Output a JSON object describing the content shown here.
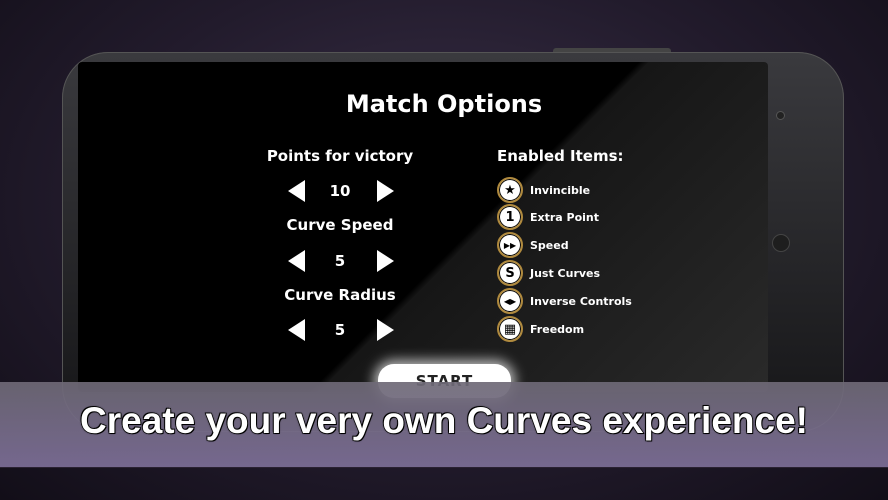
{
  "title": "Match Options",
  "settings": [
    {
      "label": "Points for victory",
      "value": "10"
    },
    {
      "label": "Curve Speed",
      "value": "5"
    },
    {
      "label": "Curve Radius",
      "value": "5"
    }
  ],
  "enabled_items": {
    "heading": "Enabled Items:",
    "items": [
      {
        "label": "Invincible",
        "icon": "star-icon",
        "glyph": "★"
      },
      {
        "label": "Extra Point",
        "icon": "one-icon",
        "glyph": "1"
      },
      {
        "label": "Speed",
        "icon": "fast-forward-icon",
        "glyph": "▶▶"
      },
      {
        "label": "Just Curves",
        "icon": "s-curve-icon",
        "glyph": "S"
      },
      {
        "label": "Inverse Controls",
        "icon": "inverse-arrows-icon",
        "glyph": "◀▶"
      },
      {
        "label": "Freedom",
        "icon": "freedom-grid-icon",
        "glyph": "▦"
      }
    ]
  },
  "start_label": "START",
  "banner_text": "Create your very own Curves experience!",
  "colors": {
    "item_ring": "#b08a3e",
    "banner": "#7a6c94"
  }
}
